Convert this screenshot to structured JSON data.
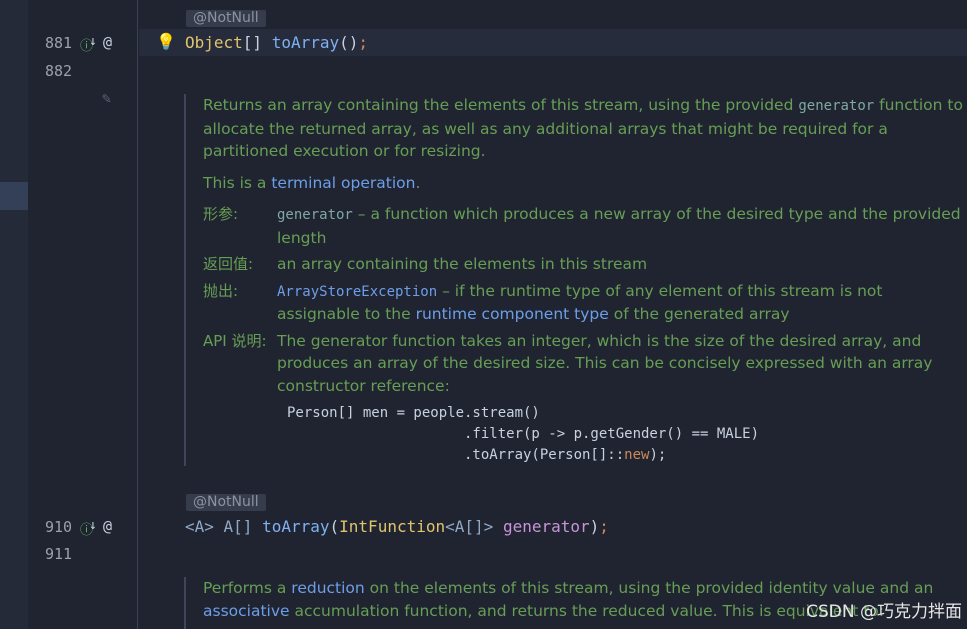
{
  "gutter": {
    "line_881": "881",
    "line_882": "882",
    "line_910": "910",
    "line_911": "911"
  },
  "method1": {
    "annotation": "@NotNull",
    "return_type": "Object",
    "brackets": "[]",
    "name": "toArray",
    "parens": "()",
    "semi": ";"
  },
  "doc1": {
    "p1_a": "Returns an array containing the elements of this stream, using the provided ",
    "p1_code": "generator",
    "p1_b": " function to allocate the returned array, as well as any additional arrays that might be required for a partitioned execution or for resizing.",
    "p2_a": "This is a ",
    "p2_link": "terminal operation",
    "p2_b": ".",
    "params_label": "形参:",
    "params_code": "generator",
    "params_text": " – a function which produces a new array of the desired type and the provided length",
    "returns_label": "返回值:",
    "returns_text": "an array containing the elements in this stream",
    "throws_label": "抛出:",
    "throws_code": "ArrayStoreException",
    "throws_a": " – if the runtime type of any element of this stream is not assignable to the ",
    "throws_link": "runtime component type",
    "throws_b": " of the generated array",
    "api_label": "API 说明:",
    "api_text": "The generator function takes an integer, which is the size of the desired array, and produces an array of the desired size. This can be concisely expressed with an array constructor reference:",
    "code_1": "Person[] men = people.stream()",
    "code_2": "                     .filter(p -> p.getGender() == MALE)",
    "code_3a": "                     .toArray(Person[]::",
    "code_3b": "new",
    "code_3c": ");"
  },
  "method2": {
    "annotation": "@NotNull",
    "tparam_open": "<A> ",
    "type": "A[]",
    "name": "toArray",
    "paren_open": "(",
    "param_type": "IntFunction",
    "generic": "<A[]>",
    "param_name": "generator",
    "paren_close": ")",
    "semi": ";"
  },
  "doc2": {
    "a": "Performs a ",
    "link1": "reduction",
    "b": " on the elements of this stream, using the provided identity value and an ",
    "link2": "associative",
    "c": " accumulation function, and returns the reduced value. This is equivalent to:"
  },
  "watermark": "CSDN @巧克力拌面"
}
